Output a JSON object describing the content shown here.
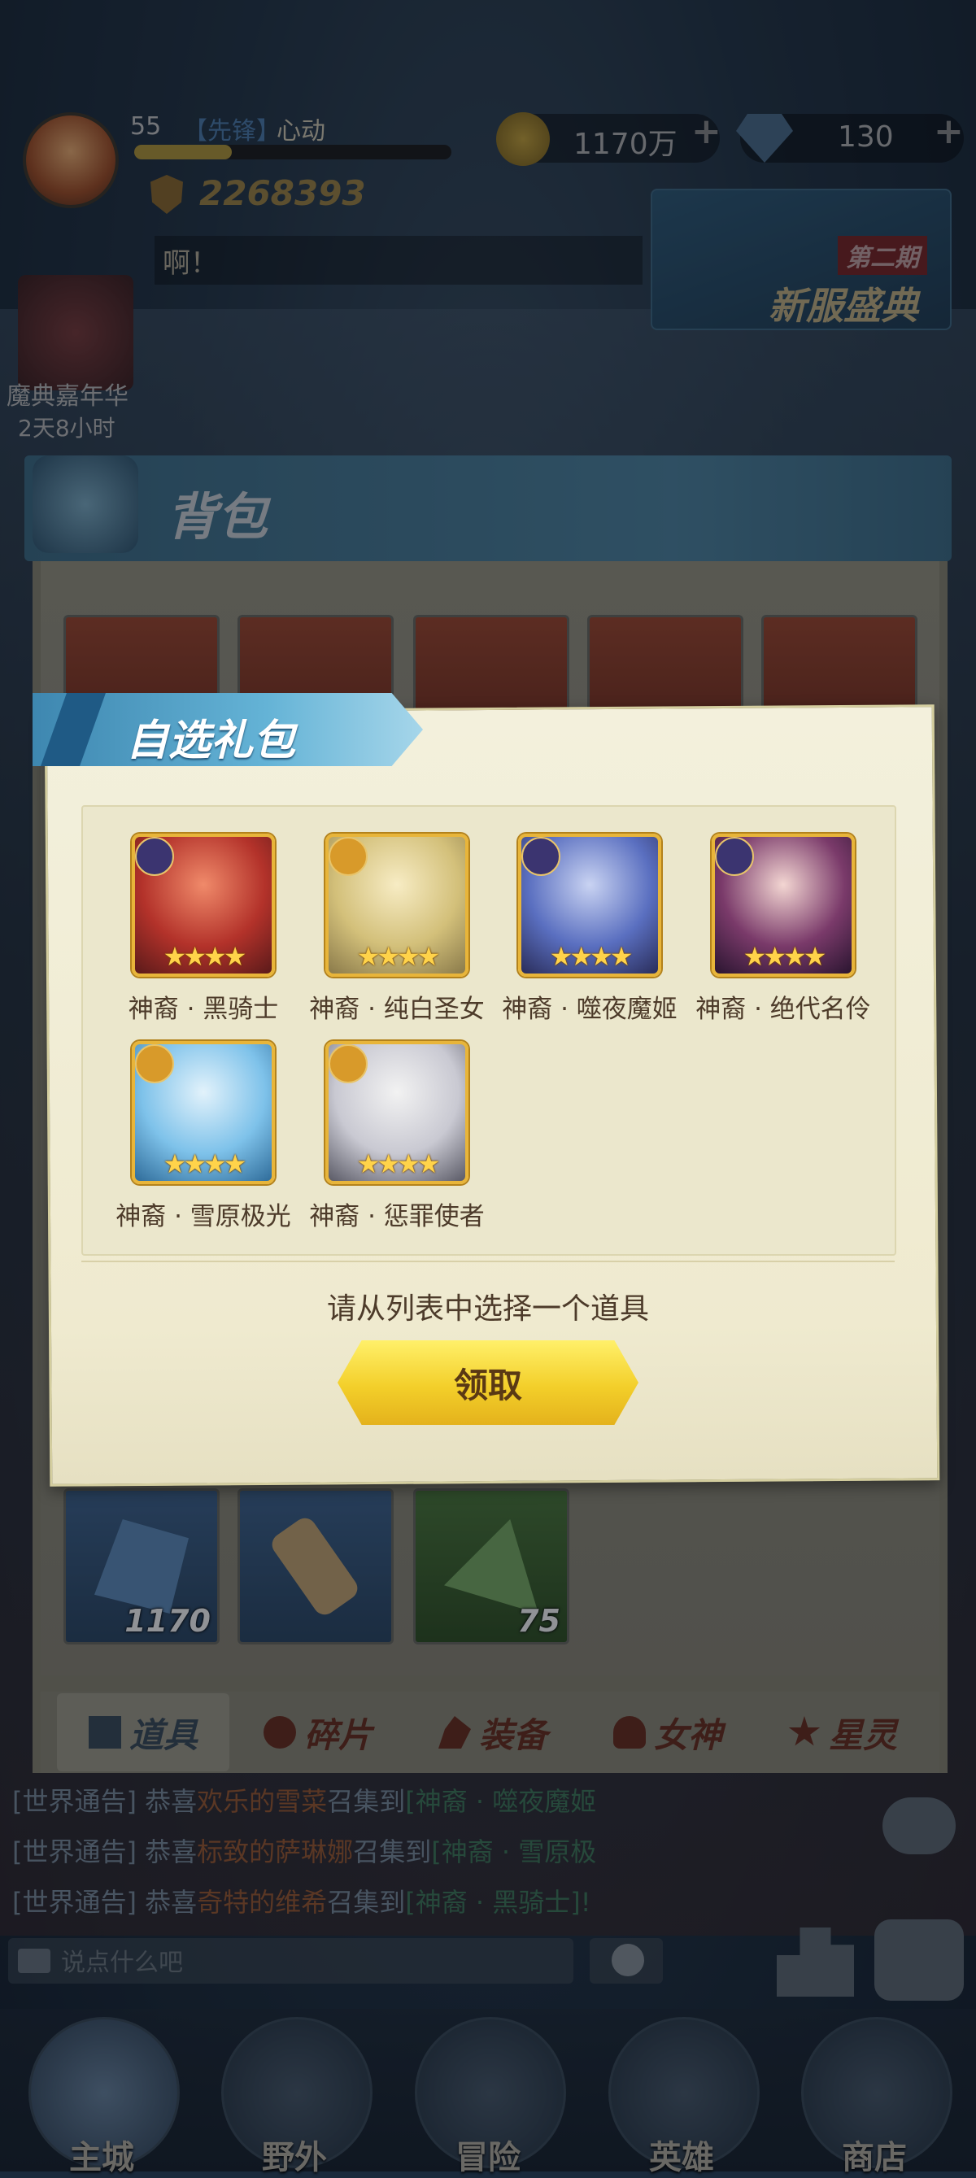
{
  "player": {
    "level": "55",
    "title_tag": "【先锋】",
    "name": "心动",
    "power": "2268393"
  },
  "resources": {
    "gold": "1170万",
    "diamonds": "130",
    "plus": "+"
  },
  "chat_preview": "啊！",
  "event": {
    "tag": "第二期",
    "title": "新服盛典"
  },
  "carnival": {
    "label": "魔典嘉年华",
    "timer": "2天8小时"
  },
  "backpack": {
    "title": "背包",
    "slots": [
      {
        "name": "all-red-item",
        "count": ""
      },
      {
        "name": "all-gold-item",
        "count": ""
      },
      {
        "name": "dark-ore-item",
        "count": ""
      },
      {
        "name": "hammer-item",
        "count": ""
      },
      {
        "name": "crystal-item",
        "count": ""
      },
      {
        "name": "blue-gem-item",
        "count": "1170"
      },
      {
        "name": "scroll-item",
        "count": ""
      },
      {
        "name": "green-crystal-item",
        "count": "75"
      }
    ],
    "tabs": [
      {
        "label": "道具",
        "active": true
      },
      {
        "label": "碎片",
        "active": false
      },
      {
        "label": "装备",
        "active": false
      },
      {
        "label": "女神",
        "active": false
      },
      {
        "label": "星灵",
        "active": false
      }
    ]
  },
  "gift_pack": {
    "title": "自选礼包",
    "heroes": [
      {
        "name": "神裔 · 黑骑士",
        "stars": "★★★★"
      },
      {
        "name": "神裔 · 纯白圣女",
        "stars": "★★★★"
      },
      {
        "name": "神裔 · 噬夜魔姬",
        "stars": "★★★★"
      },
      {
        "name": "神裔 · 绝代名伶",
        "stars": "★★★★"
      },
      {
        "name": "神裔 · 雪原极光",
        "stars": "★★★★"
      },
      {
        "name": "神裔 · 惩罪使者",
        "stars": "★★★★"
      }
    ],
    "prompt": "请从列表中选择一个道具",
    "claim_label": "领取"
  },
  "notices": [
    {
      "prefix": "[世界通告]",
      "text": "恭喜",
      "player": "欢乐的雪菜",
      "mid": "召集到",
      "hero": "[神裔 · 噬夜魔姬"
    },
    {
      "prefix": "[世界通告]",
      "text": "恭喜",
      "player": "标致的萨琳娜",
      "mid": "召集到",
      "hero": "[神裔 · 雪原极"
    },
    {
      "prefix": "[世界通告]",
      "text": "恭喜",
      "player": "奇特的维希",
      "mid": "召集到",
      "hero": "[神裔 · 黑骑士]!"
    }
  ],
  "chat_input": {
    "placeholder": "说点什么吧"
  },
  "nav": [
    {
      "label": "主城"
    },
    {
      "label": "野外"
    },
    {
      "label": "冒险"
    },
    {
      "label": "英雄"
    },
    {
      "label": "商店"
    }
  ],
  "colors": {
    "ribbon_blue": "#4b9cc5",
    "claim_yellow": "#f3cf2a",
    "modal_cream": "#f1edd6",
    "star_gold": "#ffd34a"
  }
}
